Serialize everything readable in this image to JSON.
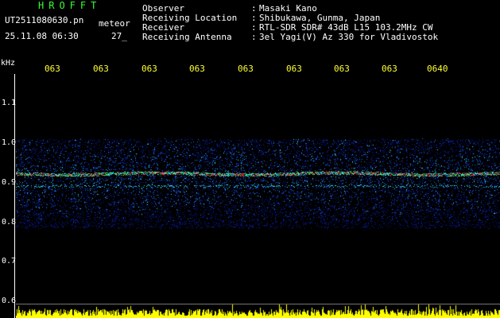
{
  "header": {
    "app_title": "HROFFT",
    "filename": "UT2511080630.pn",
    "meteor_label": "meteor",
    "timestamp": "25.11.08 06:30",
    "count": "27_",
    "fields": [
      {
        "label": "Observer",
        "value": "Masaki Kano"
      },
      {
        "label": "Receiving Location",
        "value": "Shibukawa, Gunma, Japan"
      },
      {
        "label": "Receiver",
        "value": "RTL-SDR SDR# 43dB L15 103.2MHz CW"
      },
      {
        "label": "Receiving Antenna",
        "value": "3el Yagi(V) Az 330 for Vladivostok"
      }
    ],
    "separator": ":"
  },
  "axes": {
    "unit": "kHz",
    "time_ticks": [
      "063",
      "063",
      "063",
      "063",
      "063",
      "063",
      "063",
      "063",
      "0640"
    ],
    "freq_ticks": [
      "1.1",
      "1.0",
      "0.9",
      "0.8",
      "0.7",
      "0.6"
    ]
  },
  "colors": {
    "background": "#000000",
    "title": "#33ff33",
    "time_ticks": "#ffff33",
    "text": "#ffffff",
    "noise_floor": "#ffff00",
    "signal_low": "#0a1a8c",
    "signal_mid": "#1e6ee6",
    "signal_high": "#33e6ff",
    "carrier": "#ff3333"
  },
  "spectrogram": {
    "band_low_khz": 0.8,
    "band_high_khz": 1.02,
    "carrier_khz": 0.935,
    "secondary_line_khz": 0.905,
    "axis_min_khz": 0.58,
    "axis_max_khz": 1.18
  }
}
